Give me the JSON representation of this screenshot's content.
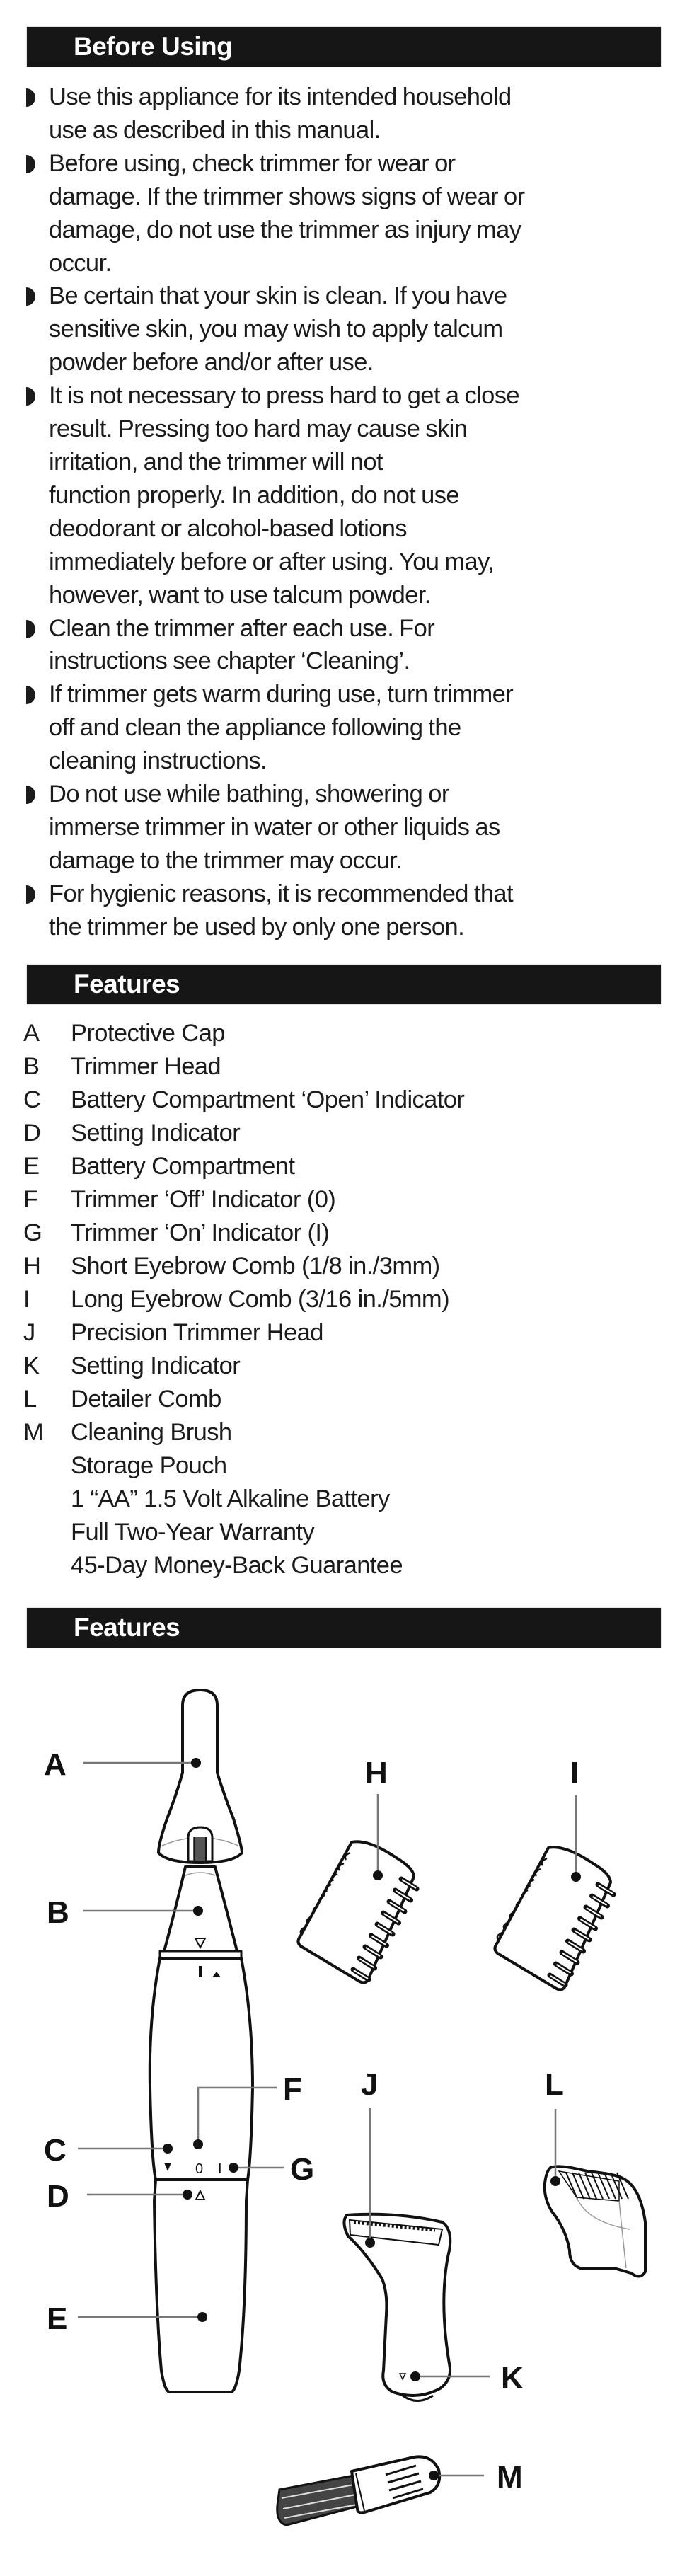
{
  "sections": {
    "before_using": {
      "title": "Before Using",
      "bullets": [
        {
          "lines": [
            "Use this appliance for its intended household",
            "use as described in this manual."
          ]
        },
        {
          "lines": [
            "Before using, check trimmer for wear or",
            "damage. If the trimmer shows signs of wear or",
            "damage, do not use the trimmer as injury may",
            "occur."
          ]
        },
        {
          "lines": [
            "Be certain that your skin is clean. If you have",
            "sensitive skin, you may wish to apply talcum",
            "powder before and/or after use."
          ]
        },
        {
          "lines": [
            "It is not necessary to press hard to get a close",
            "result.  Pressing too hard may cause skin",
            "irritation, and the trimmer will not",
            "function properly. In addition, do not use",
            "deodorant or alcohol-based lotions",
            "immediately before or after using.  You may,",
            "however, want to use talcum powder."
          ]
        },
        {
          "lines": [
            "Clean the trimmer after each use. For",
            "instructions see chapter ‘Cleaning’."
          ]
        },
        {
          "lines": [
            "If trimmer gets warm during use, turn trimmer",
            "off and clean the appliance following the",
            "cleaning instructions."
          ]
        },
        {
          "lines": [
            "Do not use while bathing, showering or",
            "immerse trimmer in water or other liquids as",
            "damage to the trimmer may occur."
          ]
        },
        {
          "lines": [
            "For hygienic reasons, it is recommended that",
            "the trimmer be used by only one person."
          ]
        }
      ]
    },
    "features_list": {
      "title": "Features",
      "items": [
        {
          "key": "A",
          "label": "Protective Cap"
        },
        {
          "key": "B",
          "label": "Trimmer Head"
        },
        {
          "key": "C",
          "label": "Battery Compartment ‘Open’ Indicator"
        },
        {
          "key": "D",
          "label": "Setting Indicator"
        },
        {
          "key": "E",
          "label": "Battery Compartment"
        },
        {
          "key": "F",
          "label": "Trimmer ‘Off’ Indicator (0)"
        },
        {
          "key": "G",
          "label": "Trimmer ‘On’ Indicator (I)"
        },
        {
          "key": "H",
          "label": "Short Eyebrow Comb (1/8 in./3mm)"
        },
        {
          "key": "I",
          "label": "Long Eyebrow Comb (3/16 in./5mm)"
        },
        {
          "key": "J",
          "label": "Precision Trimmer Head"
        },
        {
          "key": "K",
          "label": "Setting Indicator"
        },
        {
          "key": "L",
          "label": "Detailer Comb"
        },
        {
          "key": "M",
          "label": "Cleaning Brush"
        },
        {
          "key": "",
          "label": "Storage Pouch"
        },
        {
          "key": "",
          "label": "1 “AA” 1.5 Volt Alkaline Battery"
        },
        {
          "key": "",
          "label": "Full Two-Year Warranty"
        },
        {
          "key": "",
          "label": "45-Day Money-Back Guarantee"
        }
      ]
    },
    "features_diagram": {
      "title": "Features",
      "callouts": {
        "A": "A",
        "B": "B",
        "C": "C",
        "D": "D",
        "E": "E",
        "F": "F",
        "G": "G",
        "H": "H",
        "I": "I",
        "J": "J",
        "K": "K",
        "L": "L",
        "M": "M"
      },
      "switch_marks": {
        "off": "0",
        "on": "I",
        "head_mark": "I"
      }
    }
  },
  "colors": {
    "bar": "#161616",
    "bar_text": "#ffffff",
    "text": "#1b1b1b"
  }
}
